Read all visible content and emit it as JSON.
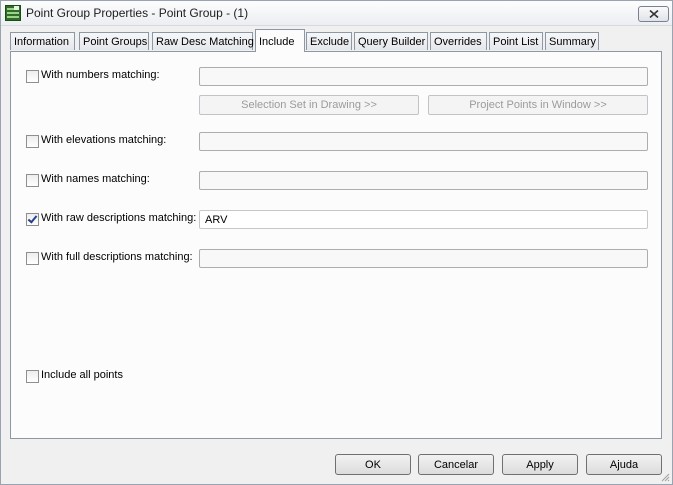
{
  "window": {
    "title": "Point Group Properties - Point Group - (1)"
  },
  "tabs": [
    {
      "label": "Information"
    },
    {
      "label": "Point Groups"
    },
    {
      "label": "Raw Desc Matching"
    },
    {
      "label": "Include"
    },
    {
      "label": "Exclude"
    },
    {
      "label": "Query Builder"
    },
    {
      "label": "Overrides"
    },
    {
      "label": "Point List"
    },
    {
      "label": "Summary"
    }
  ],
  "active_tab": "Include",
  "include": {
    "numbers": {
      "label": "With numbers matching:",
      "checked": false,
      "value": ""
    },
    "selection_set_button": "Selection Set in Drawing >>",
    "project_points_button": "Project Points in Window >>",
    "elevations": {
      "label": "With elevations matching:",
      "checked": false,
      "value": ""
    },
    "names": {
      "label": "With names matching:",
      "checked": false,
      "value": ""
    },
    "raw_descriptions": {
      "label": "With raw descriptions matching:",
      "checked": true,
      "value": "ARV"
    },
    "full_descriptions": {
      "label": "With full descriptions matching:",
      "checked": false,
      "value": ""
    },
    "include_all": {
      "label": "Include all points",
      "checked": false
    }
  },
  "buttons": {
    "ok": "OK",
    "cancel": "Cancelar",
    "apply": "Apply",
    "help": "Ajuda"
  },
  "colors": {
    "checkmark": "#24408e",
    "disabled_text": "#9b9b9b"
  },
  "icons": {
    "app": "point-group-icon",
    "close": "close-icon"
  }
}
